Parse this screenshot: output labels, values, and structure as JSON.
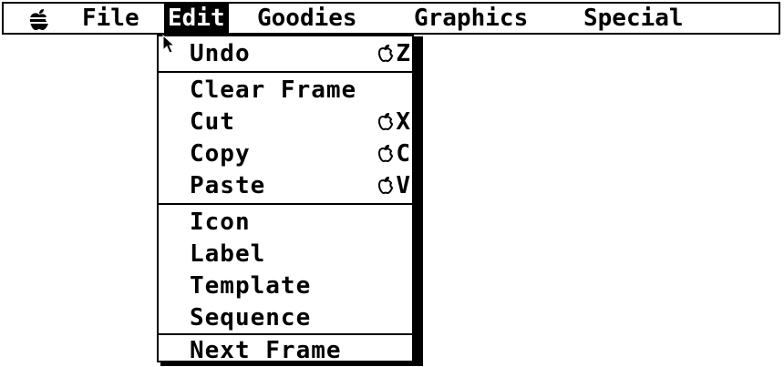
{
  "menubar": {
    "apple_icon": "apple-icon",
    "titles": [
      "File",
      "Edit",
      "Goodies",
      "Graphics",
      "Special"
    ],
    "selected": "Edit"
  },
  "edit_menu": {
    "groups": [
      [
        {
          "label": "Undo",
          "shortcut": "Z"
        }
      ],
      [
        {
          "label": "Clear Frame",
          "shortcut": ""
        },
        {
          "label": "Cut",
          "shortcut": "X"
        },
        {
          "label": "Copy",
          "shortcut": "C"
        },
        {
          "label": "Paste",
          "shortcut": "V"
        }
      ],
      [
        {
          "label": "Icon",
          "shortcut": ""
        },
        {
          "label": "Label",
          "shortcut": ""
        },
        {
          "label": "Template",
          "shortcut": ""
        },
        {
          "label": "Sequence",
          "shortcut": ""
        }
      ],
      [
        {
          "label": "Next Frame",
          "shortcut": ""
        }
      ]
    ]
  },
  "cursor_icon": "arrow-pointer-icon"
}
